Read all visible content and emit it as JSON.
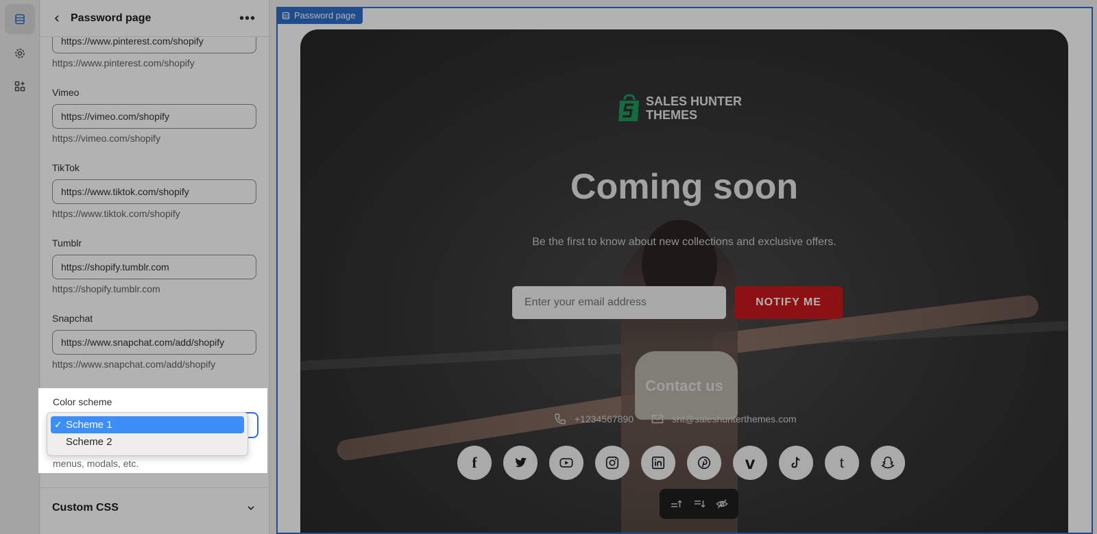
{
  "sidebar": {
    "title": "Password page",
    "fields": [
      {
        "label": "",
        "value": "https://www.pinterest.com/shopify",
        "help": "https://www.pinterest.com/shopify"
      },
      {
        "label": "Vimeo",
        "value": "https://vimeo.com/shopify",
        "help": "https://vimeo.com/shopify"
      },
      {
        "label": "TikTok",
        "value": "https://www.tiktok.com/shopify",
        "help": "https://www.tiktok.com/shopify"
      },
      {
        "label": "Tumblr",
        "value": "https://shopify.tumblr.com",
        "help": "https://shopify.tumblr.com"
      },
      {
        "label": "Snapchat",
        "value": "https://www.snapchat.com/add/shopify",
        "help": "https://www.snapchat.com/add/shopify"
      }
    ],
    "color_scheme": {
      "label": "Color scheme",
      "help_tail": "menus, modals, etc.",
      "options": [
        {
          "label": "Scheme 1",
          "selected": true
        },
        {
          "label": "Scheme 2",
          "selected": false
        }
      ]
    },
    "custom_css": "Custom CSS"
  },
  "preview": {
    "tag": "Password page",
    "logo_line1": "SALES HUNTER",
    "logo_line2": "THEMES",
    "headline": "Coming soon",
    "subtitle": "Be the first to know about new collections and exclusive offers.",
    "email_placeholder": "Enter your email address",
    "notify_label": "NOTIFY ME",
    "contact_title": "Contact us",
    "phone": "+1234567890",
    "email": "sht@saleshunterthemes.com",
    "socials": [
      "facebook-icon",
      "twitter-icon",
      "youtube-icon",
      "instagram-icon",
      "linkedin-icon",
      "pinterest-icon",
      "vimeo-icon",
      "tiktok-icon",
      "tumblr-icon",
      "snapchat-icon"
    ]
  },
  "colors": {
    "accent": "#2c6ecb",
    "notify": "#c9191a",
    "logo_green": "#1f9a5a",
    "selected_option": "#3e8ef7"
  }
}
